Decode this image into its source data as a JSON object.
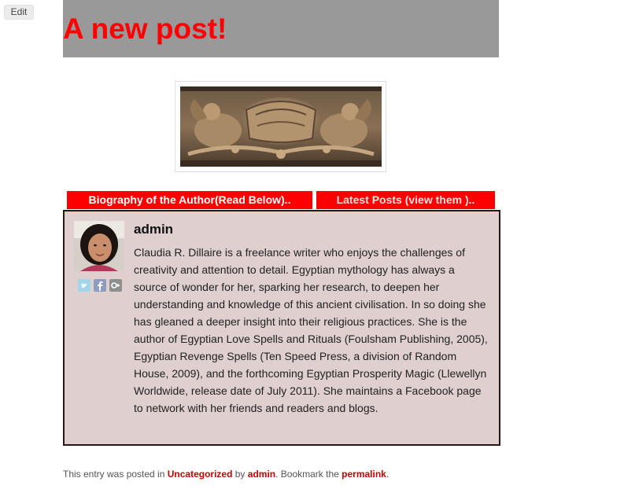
{
  "admin_bar": {
    "edit_label": "Edit"
  },
  "post": {
    "title": "A new post!"
  },
  "featured_image": {
    "subject": "carved wooden panel with cherubs"
  },
  "author_box": {
    "tabs": [
      {
        "label": "Biography of the Author(Read Below).."
      },
      {
        "label": "Latest Posts (view them ).."
      }
    ],
    "name": "admin",
    "bio": "Claudia R. Dillaire is a freelance writer who enjoys the challenges of creativity and attention to detail. Egyptian mythology has always a source of wonder for her, sparking her research, to deepen her understanding and knowledge of this ancient civilisation. In so doing she has gleaned a deeper insight into their religious practices. She is the author of Egyptian Love Spells and Rituals (Foulsham Publishing, 2005), Egyptian Revenge Spells (Ten Speed Press, a division of Random House, 2009), and the forthcoming Egyptian Prosperity Magic (Llewellyn Worldwide, release date of July 2011). She maintains a Facebook page to network with her friends and readers and blogs.",
    "social_icons": [
      "twitter-icon",
      "facebook-icon",
      "google-plus-icon"
    ]
  },
  "entry_meta": {
    "prefix": "This entry was posted in ",
    "category": "Uncategorized",
    "by": " by ",
    "author": "admin",
    "bookmark": ". Bookmark the ",
    "permalink": "permalink",
    "suffix": "."
  },
  "colors": {
    "accent": "#ff0000",
    "header_bg": "#999999",
    "author_box_bg": "#dfcfcf",
    "link": "#cc0000"
  }
}
